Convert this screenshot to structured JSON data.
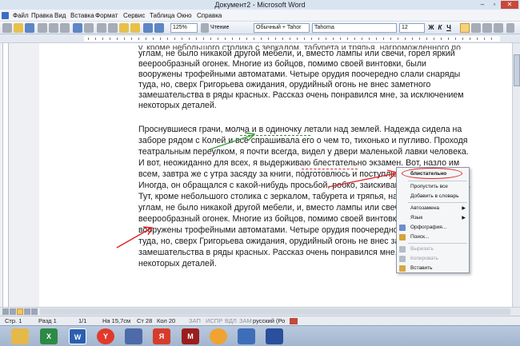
{
  "window": {
    "title": "Документ2 - Microsoft Word"
  },
  "menu": [
    "Файл",
    "Правка",
    "Вид",
    "Вставка",
    "Формат",
    "Сервис",
    "Таблица",
    "Окно",
    "Справка"
  ],
  "toolbar": {
    "zoom": "125%",
    "reading_label": "Чтение",
    "style": "Обычный + Tahor",
    "font": "Tahoma",
    "size": "12",
    "bold": "Ж",
    "italic": "К",
    "underline": "Ч"
  },
  "document": {
    "lines": [
      "углам, не было никакой другой мебели, и, вместо лампы или свечи, горел яркий",
      "веерообразный огонек. Многие из бойцов, помимо своей винтовки, были",
      "вооружены трофейными автоматами. Четыре орудия поочередно слали снаряды",
      "туда, но, сверх Григорьева ожидания, орудийный огонь не внес заметного",
      "замешательства в ряды красных. Рассказ очень понравился мне, за исключением",
      "некоторых деталей.",
      "",
      " Проснувшиеся грачи, молча и в одиночку летали над землей. Надежда сидела на",
      "заборе рядом с Колей и все спрашивала его о чем то, тихонько и пугливо. Проходя",
      "театральным переулком, я почти всегда, видел у двери маленькой лавки человека.",
      "И вот, неожиданно для всех, я выдерживаю блестательно экзамен. Вот, назло им",
      "всем, завтра же с утра засяду за книги, подготовлюсь и поступлю в академию.",
      "Иногда, он обращался с какой-нибудь просьбой, робко, заискивающе, чуть слышно.",
      "Тут, кроме небольшого столика с зеркалом, табурета и тряпья, нагроможденного по",
      "углам, не было никакой другой мебели, и, вместо лампы или свечи, горел яркий",
      "веерообразный огонек. Многие из бойцов, помимо своей винтовки, были",
      "вооружены трофейными автоматами. Четыре орудия поочередно слали снаряды",
      "туда, но, сверх Григорьева ожидания, орудийный огонь не внес заметного",
      "замешательства в ряды красных. Рассказ очень понравился мне, за исключением",
      "некоторых деталей."
    ]
  },
  "context_menu": {
    "items": [
      "блистательно",
      "Пропустить все",
      "Добавить в словарь",
      "Автозамена",
      "Язык",
      "Орфография...",
      "Поиск...",
      "Вырезать",
      "Копировать",
      "Вставить"
    ]
  },
  "statusbar": {
    "page": "Стр.  1",
    "section": "Разд  1",
    "pages": "1/1",
    "position": "На  15,7см",
    "line": "Ст  28",
    "column": "Кол  20",
    "rec": "ЗАП",
    "trk": "ИСПР",
    "ext": "ВДЛ",
    "ovr": "ЗАМ",
    "language": "русский (Ро"
  },
  "colors": {
    "annotation_arrow": "#e02020",
    "grammar_underline": "#3a8a3a",
    "spelling_underline": "#d03030",
    "title_bar": "#d9e4f1"
  }
}
